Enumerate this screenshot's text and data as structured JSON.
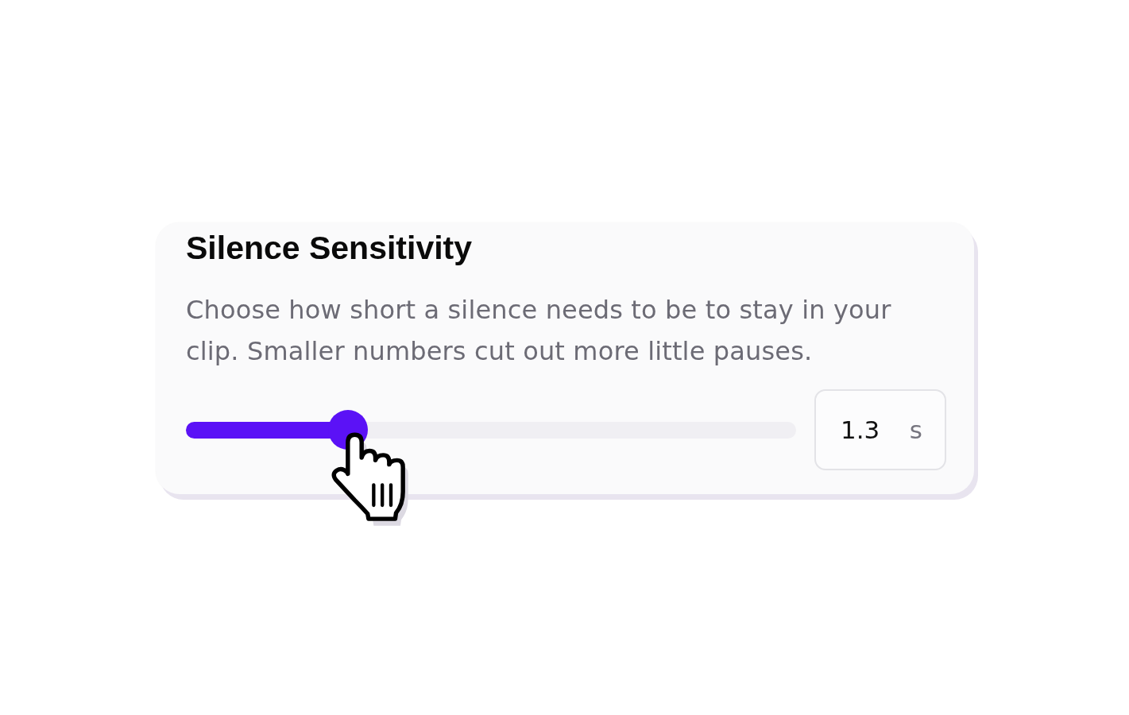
{
  "card": {
    "title": "Silence Sensitivity",
    "description": "Choose how short a silence needs to be to stay in your clip. Smaller numbers cut out more little pauses.",
    "slider": {
      "level": 0.265
    },
    "duration_field": {
      "value": "1.3",
      "unit": "s"
    }
  }
}
